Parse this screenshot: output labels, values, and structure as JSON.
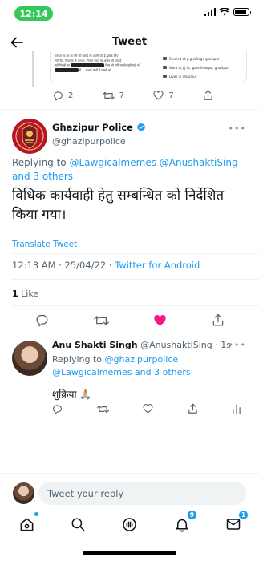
{
  "status_bar": {
    "time": "12:14",
    "battery_level": 0.85
  },
  "header": {
    "title": "Tweet"
  },
  "previous_tweet": {
    "quoted_lines": [
      "सरकार सा पर सा परी की सलाई  जो अपनी एंउ है, इसके लिए",
      "गिलचिंत, नितायक के  अनयत, निजक रकत का अयोग भी गया है ।",
      "बड़ी गिरोहों का",
      "है ... सभाई जाती है इसली को ..."
    ],
    "redacted_line": "मिक जो गयी जाकोर दही पद्दो को",
    "profile_info": [
      "Studied at p.g.college ghazipur",
      "Went to j.j.i.c. gandhinagar, ghazipur",
      "Lives in Ghazipur"
    ],
    "reply_count": "2",
    "retweet_count": "7",
    "like_count": "7"
  },
  "main_tweet": {
    "author_name": "Ghazipur Police",
    "author_handle": "@ghazipurpolice",
    "replying_to_prefix": "Replying to ",
    "replying_to_users": "@Lawgicalmemes @AnushaktiSing and 3 others",
    "text": "विधिक कार्यवाही हेतु सम्बन्धित को निर्देशित किया गया।",
    "translate_label": "Translate Tweet",
    "timestamp": "12:13 AM · 25/04/22 · ",
    "source": "Twitter for Android",
    "likes_count": "1",
    "likes_label": " Like"
  },
  "reply": {
    "author_name": "Anu Shakti Singh",
    "author_handle": " @AnushaktiSing · 1s",
    "replying_to_prefix": "Replying to ",
    "replying_to_users": "@ghazipurpolice @Lawgicalmemes and 3 others",
    "text": "शुक्रिया 🙏🏼"
  },
  "compose": {
    "placeholder": "Tweet your reply"
  },
  "nav": {
    "notifications_badge": "9",
    "messages_badge": "1"
  },
  "colors": {
    "accent": "#1d9bf0",
    "like_active": "#f91880",
    "status_green": "#34c759"
  },
  "icons": [
    "back-arrow-icon",
    "reply-icon",
    "retweet-icon",
    "like-icon",
    "share-icon",
    "analytics-icon",
    "verified-badge-icon",
    "home-icon",
    "search-icon",
    "spaces-icon",
    "notifications-icon",
    "messages-icon"
  ]
}
